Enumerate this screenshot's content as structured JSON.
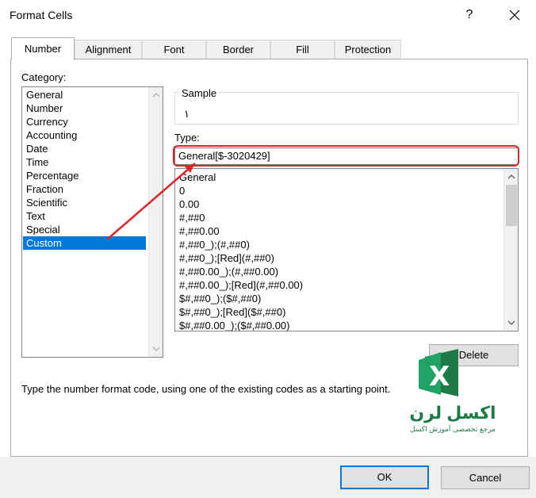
{
  "window": {
    "title": "Format Cells",
    "help_label": "?"
  },
  "tabs": [
    {
      "label": "Number",
      "active": true
    },
    {
      "label": "Alignment"
    },
    {
      "label": "Font"
    },
    {
      "label": "Border"
    },
    {
      "label": "Fill"
    },
    {
      "label": "Protection"
    }
  ],
  "category": {
    "label": "Category:",
    "items": [
      "General",
      "Number",
      "Currency",
      "Accounting",
      "Date",
      "Time",
      "Percentage",
      "Fraction",
      "Scientific",
      "Text",
      "Special",
      "Custom"
    ],
    "selected": "Custom"
  },
  "sample": {
    "label": "Sample",
    "value": "١"
  },
  "type": {
    "label": "Type:",
    "value": "General[$-3020429]",
    "codes": [
      "General",
      "0",
      "0.00",
      "#,##0",
      "#,##0.00",
      "#,##0_);(#,##0)",
      "#,##0_);[Red](#,##0)",
      "#,##0.00_);(#,##0.00)",
      "#,##0.00_);[Red](#,##0.00)",
      "$#,##0_);($#,##0)",
      "$#,##0_);[Red]($#,##0)",
      "$#,##0.00_);($#,##0.00)"
    ]
  },
  "delete_label": "Delete",
  "hint": "Type the number format code, using one of the existing codes as a starting point.",
  "watermark": {
    "title": "اکسل لرن",
    "subtitle": "مرجع تخصصی آموزش اکسل"
  },
  "buttons": {
    "ok": "OK",
    "cancel": "Cancel"
  },
  "colors": {
    "accent": "#0078d7",
    "highlight": "#d7262c",
    "brand": "#1e7b47"
  }
}
